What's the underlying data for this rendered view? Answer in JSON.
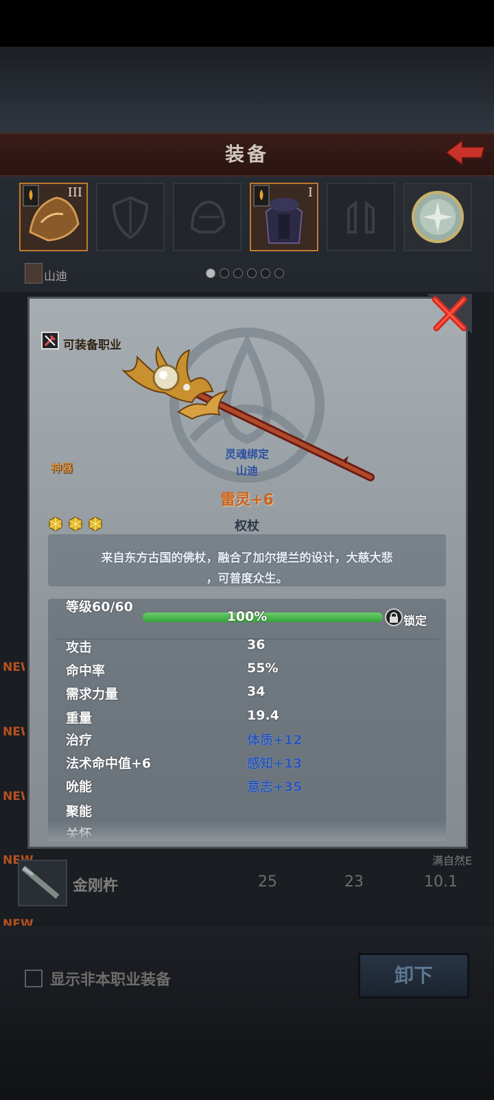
{
  "header": {
    "title": "装备"
  },
  "slots": [
    {
      "tier": "III",
      "active": true
    },
    {
      "tier": "",
      "active": false
    },
    {
      "tier": "",
      "active": false
    },
    {
      "tier": "I",
      "active": true
    },
    {
      "tier": "",
      "active": false
    },
    {
      "tier": "",
      "active": false
    }
  ],
  "character": {
    "name": "山迪"
  },
  "pager": {
    "total": 6,
    "current": 1
  },
  "list": {
    "new_tags": [
      "NEW",
      "NEW",
      "NEW",
      "NEW",
      "NEW"
    ],
    "row": {
      "name": "金刚杵",
      "values": [
        "25",
        "23",
        "10.1"
      ],
      "tag": "满自然E"
    }
  },
  "footer": {
    "nonclass_label": "显示非本职业装备",
    "unequip_label": "卸下"
  },
  "popup": {
    "class_label": "可装备职业",
    "rarity": "神器",
    "soulbound_label": "灵魂绑定",
    "soulbound_owner": "山迪",
    "item_name": "雷灵+6",
    "item_type": "权杖",
    "gem_count": 3,
    "description_line1": "来自东方古国的佛杖，融合了加尔提兰的设计，大慈大悲",
    "description_line2": "，可普度众生。",
    "level": {
      "label": "等级60/60",
      "percent_text": "100%",
      "fill": 1.0,
      "lock_label": "锁定"
    },
    "stats": [
      {
        "label": "攻击",
        "value": "36",
        "blue": false
      },
      {
        "label": "命中率",
        "value": "55%",
        "blue": false
      },
      {
        "label": "需求力量",
        "value": "34",
        "blue": false
      },
      {
        "label": "重量",
        "value": "19.4",
        "blue": false
      },
      {
        "label": "治疗",
        "value": "体质+12",
        "blue": true
      },
      {
        "label": "法术命中值+6",
        "value": "感知+13",
        "blue": true
      },
      {
        "label": "吮能",
        "value": "意志+35",
        "blue": true
      },
      {
        "label": "聚能",
        "value": "",
        "blue": false
      },
      {
        "label": "关怀",
        "value": "",
        "blue": false
      }
    ]
  },
  "colors": {
    "accent": "#c27a2c",
    "bonus_blue": "#2b55b0",
    "rarity": "#d89040",
    "item_name": "#c86424",
    "level_bar": "#4cbb4c"
  }
}
